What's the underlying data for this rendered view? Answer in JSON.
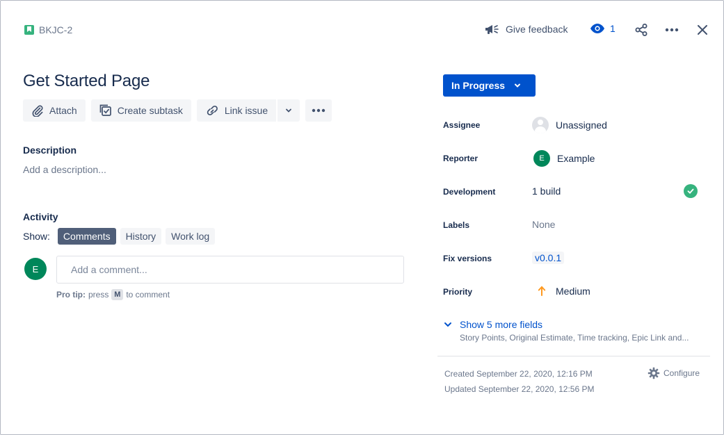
{
  "issue": {
    "key": "BKJC-2",
    "title": "Get Started Page"
  },
  "header": {
    "feedback_label": "Give feedback",
    "watch_count": "1"
  },
  "actions": {
    "attach": "Attach",
    "create_subtask": "Create subtask",
    "link_issue": "Link issue"
  },
  "description": {
    "heading": "Description",
    "placeholder": "Add a description..."
  },
  "activity": {
    "heading": "Activity",
    "show_label": "Show:",
    "filters": [
      "Comments",
      "History",
      "Work log"
    ],
    "active_filter": "Comments",
    "user_initial": "E",
    "comment_placeholder": "Add a comment...",
    "protip_bold": "Pro tip:",
    "protip_press": "press",
    "protip_key": "M",
    "protip_rest": "to comment"
  },
  "status": {
    "label": "In Progress"
  },
  "fields": {
    "assignee": {
      "label": "Assignee",
      "value": "Unassigned"
    },
    "reporter": {
      "label": "Reporter",
      "value": "Example",
      "initial": "E"
    },
    "development": {
      "label": "Development",
      "value": "1 build"
    },
    "labels": {
      "label": "Labels",
      "value": "None"
    },
    "fix_versions": {
      "label": "Fix versions",
      "value": "v0.0.1"
    },
    "priority": {
      "label": "Priority",
      "value": "Medium"
    }
  },
  "more_fields": {
    "label": "Show 5 more fields",
    "summary": "Story Points, Original Estimate, Time tracking, Epic Link and..."
  },
  "meta": {
    "created": "Created September 22, 2020, 12:16 PM",
    "updated": "Updated September 22, 2020, 12:56 PM",
    "configure": "Configure"
  },
  "colors": {
    "primary": "#0052cc",
    "story_green": "#36b37e",
    "avatar_green": "#00875a",
    "priority_orange": "#ff991f"
  },
  "icons": {
    "issue_type": "story-icon",
    "feedback": "megaphone-icon",
    "watch": "eye-icon",
    "share": "share-icon",
    "more": "more-icon",
    "close": "close-icon",
    "attach": "paperclip-icon",
    "subtask": "subtask-icon",
    "link": "link-icon",
    "priority": "arrow-up-icon",
    "configure": "gear-icon"
  }
}
